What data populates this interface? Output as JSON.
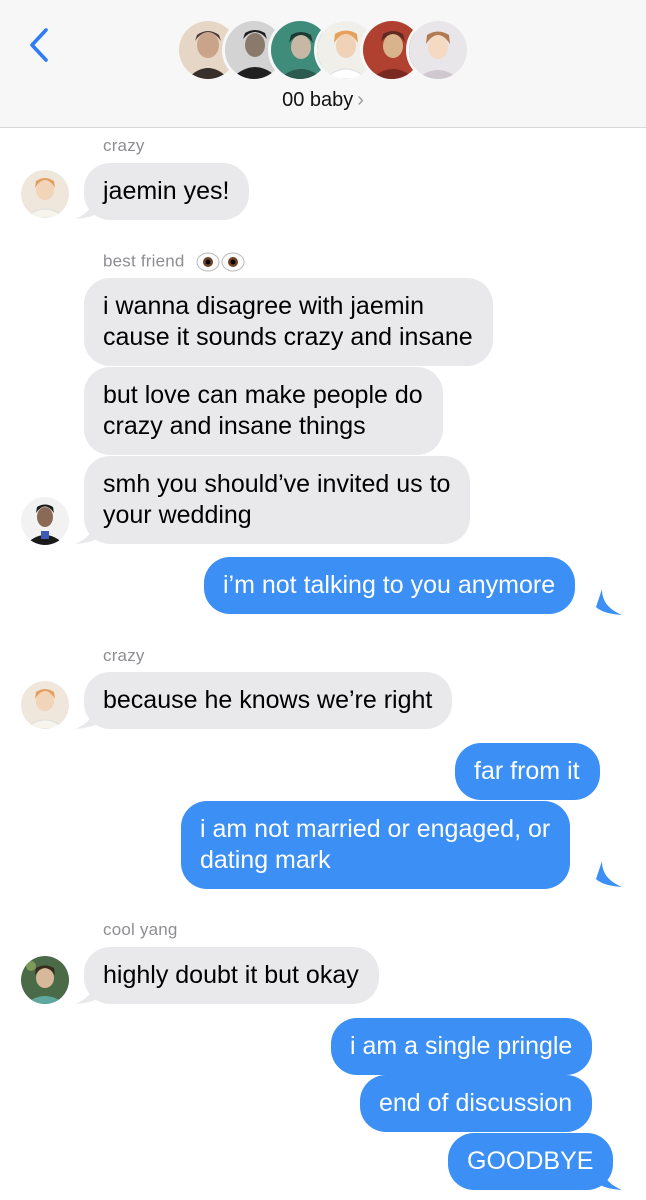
{
  "header": {
    "group_name": "00 baby",
    "chevron": "›",
    "back_icon": "chevron-left-icon",
    "accent": "#2f7cf6",
    "participants": [
      {
        "icon": "avatar-photo-1",
        "colors": [
          "#ead7c6",
          "#4a3b35",
          "#c9a48a"
        ]
      },
      {
        "icon": "avatar-photo-2",
        "colors": [
          "#d5d5d5",
          "#202020",
          "#8a7a6c"
        ]
      },
      {
        "icon": "avatar-photo-3",
        "colors": [
          "#3f8c7a",
          "#1e3b33",
          "#c7b7a5"
        ]
      },
      {
        "icon": "avatar-photo-4",
        "colors": [
          "#f1efe9",
          "#e6a05a",
          "#ffffff"
        ]
      },
      {
        "icon": "avatar-photo-5",
        "colors": [
          "#b04030",
          "#d9b38c",
          "#5e2a22"
        ]
      },
      {
        "icon": "avatar-photo-6",
        "colors": [
          "#e9e6ea",
          "#b17b52",
          "#f4d9c3"
        ]
      }
    ]
  },
  "colors": {
    "incoming_bubble": "#e9e9eb",
    "outgoing_bubble": "#3b8ff5",
    "sender_label": "#8e8e93"
  },
  "conversation": {
    "crazy_1": {
      "sender": "crazy",
      "m1": "jaemin yes!"
    },
    "best_friend": {
      "sender": "best friend",
      "eyes_icon": "eyes-emoji-icon",
      "m1_l1": "i wanna disagree with jaemin",
      "m1_l2": "cause it sounds crazy and insane",
      "m2_l1": "but love can make people do",
      "m2_l2": "crazy and insane things",
      "m3_l1": "smh you should’ve invited us to",
      "m3_l2": "your wedding"
    },
    "me_1": {
      "m1": "i’m not talking to you anymore"
    },
    "crazy_2": {
      "sender": "crazy",
      "m1": "because he knows we’re right"
    },
    "me_2": {
      "m1": "far from it",
      "m2_l1": "i am not married or engaged, or",
      "m2_l2": "dating mark"
    },
    "cool_yang": {
      "sender": "cool yang",
      "m1": "highly doubt it but okay"
    },
    "me_3": {
      "m1": "i am a single pringle",
      "m2": "end of discussion",
      "m3": "GOODBYE"
    }
  }
}
